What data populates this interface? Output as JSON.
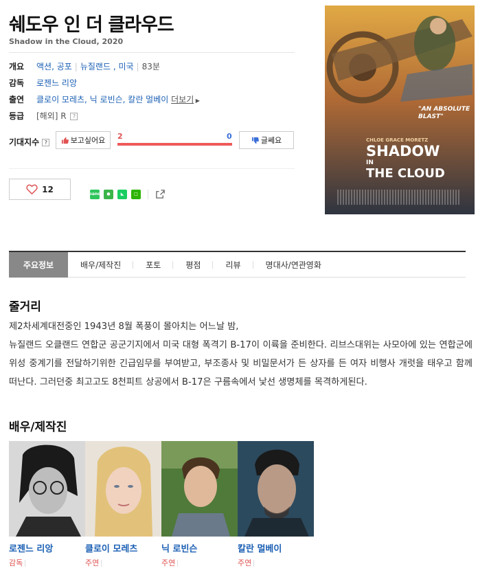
{
  "movie": {
    "title": "쉐도우 인 더 클라우드",
    "subtitle": "Shadow in the Cloud, 2020"
  },
  "info": {
    "overview_label": "개요",
    "genres": "액션, 공포",
    "countries": "뉴질랜드 , 미국",
    "runtime": "83분",
    "director_label": "감독",
    "director": "로젠느 리앙",
    "cast_label": "출연",
    "cast": "클로이 모레츠, 닉 로빈슨, 칼란 멀베이",
    "more_label": "더보기",
    "rating_label": "등급",
    "rating_region": "[해외]",
    "rating": "R",
    "help": "?"
  },
  "expectation": {
    "label": "기대지수",
    "want_label": "보고싶어요",
    "doubt_label": "글쎄요",
    "want_count": "2",
    "doubt_count": "0",
    "want_ratio": 1.0
  },
  "like": {
    "count": "12"
  },
  "share_icons": [
    "band-icon",
    "line-icon",
    "bookmark-icon",
    "green-square-icon",
    "share-icon"
  ],
  "tabs": [
    "주요정보",
    "배우/제작진",
    "포토",
    "평점",
    "리뷰",
    "명대사/연관영화"
  ],
  "synopsis": {
    "heading": "줄거리",
    "line1": "제2차세계대전중인 1943년 8월 폭풍이 몰아치는 어느날 밤,",
    "line2": "뉴질랜드 오클랜드 연합군 공군기지에서 미국 대형 폭격기 B-17이 이륙을 준비한다. 리브스대위는 사모아에 있는 연합군에 위성 중계기를 전달하기위한 긴급임무를 부여받고, 부조종사 및 비밀문서가 든 상자를 든 여자 비행사 개럿을 태우고 함께 떠난다. 그러던중 최고고도 8천피트 상공에서 B-17은 구름속에서 낯선 생명체를 목격하게된다."
  },
  "cast_section": {
    "heading": "배우/제작진",
    "people": [
      {
        "name": "로젠느 리앙",
        "role": "감독"
      },
      {
        "name": "클로이 모레츠",
        "role": "주연"
      },
      {
        "name": "닉 로빈슨",
        "role": "주연"
      },
      {
        "name": "칼란 멀베이",
        "role": "주연"
      }
    ]
  },
  "poster": {
    "quote": "\"AN ABSOLUTE BLAST\"",
    "actor": "CHLOE GRACE MORETZ",
    "title_line1": "SHADOW",
    "title_line2": "IN",
    "title_line3": "THE CLOUD"
  },
  "colors": {
    "link": "#1a5fb4",
    "accent_red": "#ee5a5a",
    "accent_blue": "#3a6fd8",
    "tab_active": "#888888"
  }
}
